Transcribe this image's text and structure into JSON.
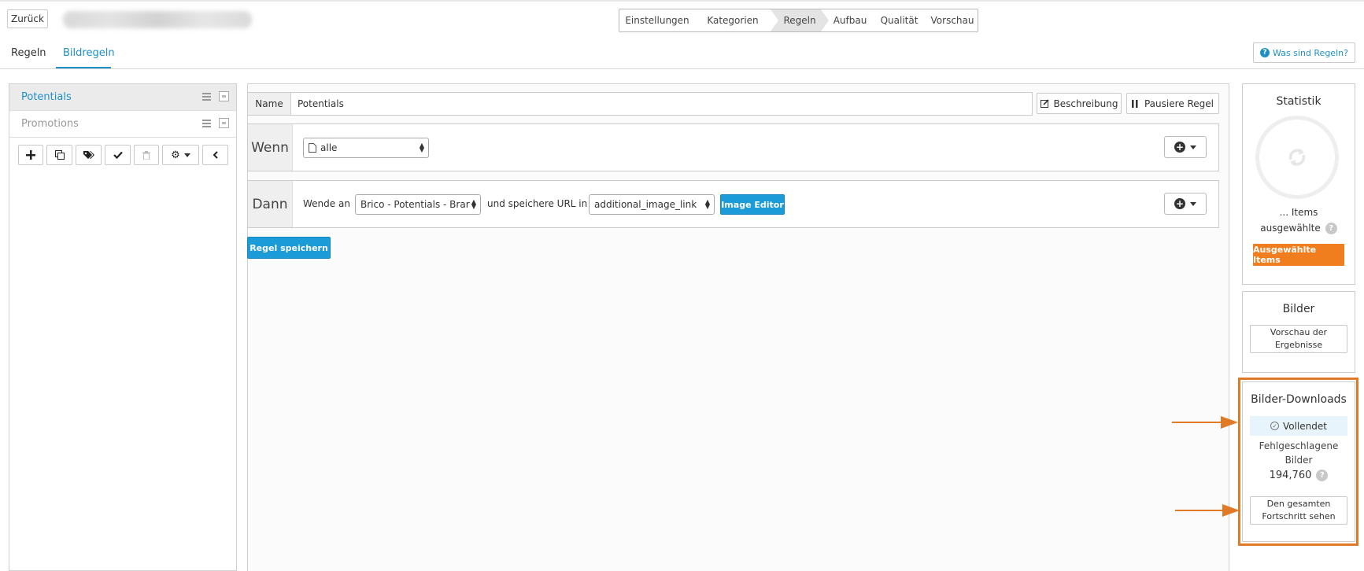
{
  "header": {
    "back_label": "Zurück",
    "steps": [
      "Einstellungen",
      "Kategorien",
      "Regeln",
      "Aufbau",
      "Qualität",
      "Vorschau"
    ],
    "active_step": "Regeln",
    "help_link": "Was sind Regeln?"
  },
  "subtabs": {
    "tab1": "Regeln",
    "tab2": "Bildregeln",
    "active": "Bildregeln"
  },
  "rules": {
    "items": [
      {
        "label": "Potentials"
      },
      {
        "label": "Promotions"
      }
    ],
    "selected": "Potentials"
  },
  "editor": {
    "name_label": "Name",
    "name_value": "Potentials",
    "description_button": "Beschreibung",
    "pause_button": "Pausiere Regel",
    "when_label": "Wenn",
    "when_select": "alle",
    "then_label": "Dann",
    "apply_text": "Wende an",
    "apply_select": "Brico - Potentials - Brar",
    "save_url_text": "und speichere URL in",
    "url_select": "additional_image_link",
    "image_editor_button": "Image Editor",
    "save_rule_button": "Regel speichern"
  },
  "statistik": {
    "title": "Statistik",
    "items_text": "... Items",
    "selected_text": "ausgewählte",
    "selected_button": "Ausgewählte Items"
  },
  "bilder": {
    "title": "Bilder",
    "preview_button_line1": "Vorschau der",
    "preview_button_line2": "Ergebnisse"
  },
  "downloads": {
    "title": "Bilder-Downloads",
    "status": "Vollendet",
    "failed_line1": "Fehlgeschlagene",
    "failed_line2": "Bilder",
    "failed_count": "194,760",
    "progress_button_line1": "Den gesamten",
    "progress_button_line2": "Fortschritt sehen"
  },
  "colors": {
    "accent": "#1e90c8",
    "primary_button": "#1b9bd7",
    "orange_button": "#f07e1f",
    "highlight_frame": "#e07a26",
    "status_bg": "#e8f4fb"
  }
}
